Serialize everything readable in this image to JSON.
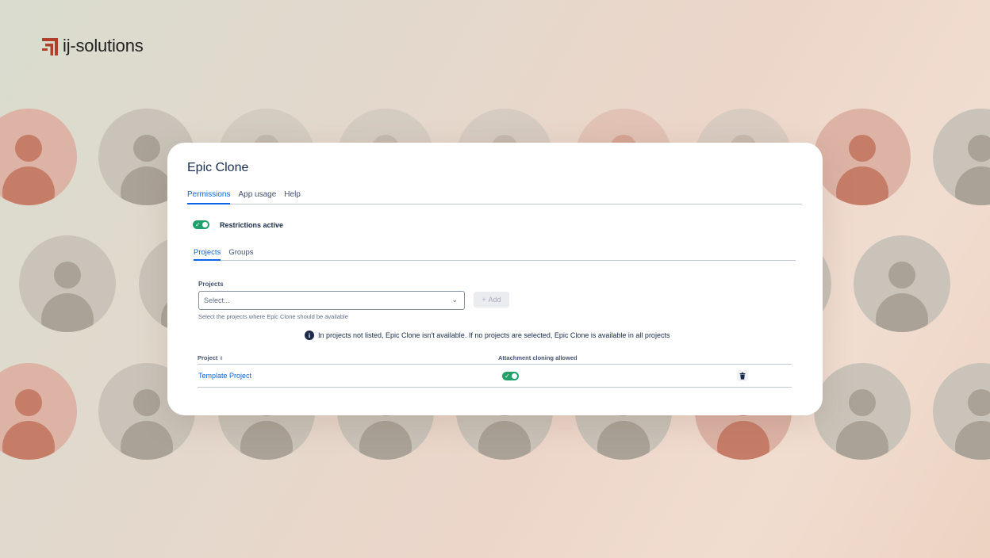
{
  "brand": {
    "logo_text": "ij-solutions",
    "logo_color": "#b0402b"
  },
  "app": {
    "title": "Epic Clone",
    "tabs": [
      {
        "label": "Permissions",
        "active": true
      },
      {
        "label": "App usage",
        "active": false
      },
      {
        "label": "Help",
        "active": false
      }
    ]
  },
  "restrictions": {
    "label": "Restrictions active",
    "enabled": true
  },
  "sub_tabs": [
    {
      "label": "Projects",
      "active": true
    },
    {
      "label": "Groups",
      "active": false
    }
  ],
  "projects_field": {
    "label": "Projects",
    "placeholder": "Select...",
    "add_label": "Add",
    "helper": "Select the projects where Epic Clone should be available"
  },
  "info_message": "In projects not listed, Epic Clone isn't available. If no projects are selected, Epic Clone is available in all projects",
  "table": {
    "headers": {
      "project": "Project",
      "attachment": "Attachment cloning allowed"
    },
    "rows": [
      {
        "project": "Template Project",
        "attachment_cloning": true
      }
    ]
  },
  "colors": {
    "accent": "#0c66e4",
    "toggle_on": "#22a06b",
    "text": "#172b4d"
  },
  "icons": [
    "check-icon",
    "chevron-down-icon",
    "plus-icon",
    "info-icon",
    "sort-icon",
    "trash-icon",
    "user-icon"
  ]
}
